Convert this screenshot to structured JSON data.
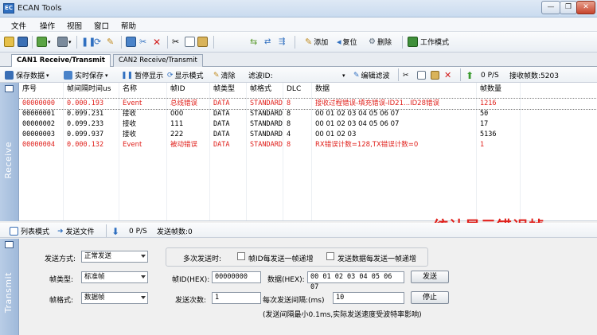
{
  "window": {
    "title": "ECAN Tools",
    "app_icon_text": "EC",
    "min": "—",
    "max": "❐",
    "close": "✕"
  },
  "menu": [
    "文件",
    "操作",
    "视图",
    "窗口",
    "帮助"
  ],
  "toolbar": {
    "add_label": "添加",
    "reset_label": "复位",
    "delete_label": "删除",
    "mode_label": "工作模式"
  },
  "tabs": [
    "CAN1 Receive/Transmit",
    "CAN2 Receive/Transmit"
  ],
  "rx_toolbar": {
    "save_data": "保存数据",
    "realtime_save": "实时保存",
    "pause_display": "暂停显示",
    "display_mode": "显示模式",
    "clear": "清除",
    "filter_id_label": "滤波ID:",
    "edit_filter": "编辑滤波",
    "rate": "0 P/S",
    "recv_frames": "接收帧数:5203"
  },
  "receive_label": "Receive",
  "transmit_label": "Transmit",
  "grid": {
    "columns": [
      "序号",
      "帧间隔时间us",
      "名称",
      "帧ID",
      "帧类型",
      "帧格式",
      "DLC",
      "数据",
      "帧数量"
    ],
    "rows": [
      {
        "cells": [
          "00000000",
          "0.000.193",
          "Event",
          "总线错误",
          "DATA",
          "STANDARD",
          "8",
          "接收过程错误-填充错误-ID21...ID28错误",
          "1216"
        ],
        "error": true
      },
      {
        "cells": [
          "00000001",
          "0.099.231",
          "接收",
          "000",
          "DATA",
          "STANDARD",
          "8",
          "00 01 02 03 04 05 06 07",
          "50"
        ],
        "error": false
      },
      {
        "cells": [
          "00000002",
          "0.099.233",
          "接收",
          "111",
          "DATA",
          "STANDARD",
          "8",
          "00 01 02 03 04 05 06 07",
          "17"
        ],
        "error": false
      },
      {
        "cells": [
          "00000003",
          "0.099.937",
          "接收",
          "222",
          "DATA",
          "STANDARD",
          "4",
          "00 01 02 03",
          "5136"
        ],
        "error": false
      },
      {
        "cells": [
          "00000004",
          "0.000.132",
          "Event",
          "被动错误",
          "DATA",
          "STANDARD",
          "8",
          "RX错误计数=128,TX错误计数=0",
          "1"
        ],
        "error": true
      }
    ]
  },
  "tx_toolbar": {
    "list_mode": "列表模式",
    "send_file": "发送文件",
    "rate": "0 P/S",
    "sent_frames": "发送帧数:0"
  },
  "annotation": "统计显示错误帧",
  "tx": {
    "send_mode_label": "发送方式:",
    "send_mode_value": "正常发送",
    "multi_send_label": "多次发送时:",
    "id_increment_label": "帧ID每发送一帧递增",
    "data_increment_label": "发送数据每发送一帧递增",
    "frame_type_label": "帧类型:",
    "frame_type_value": "标准帧",
    "frame_id_label": "帧ID(HEX):",
    "frame_id_value": "00000000",
    "data_label": "数据(HEX):",
    "data_value": "00 01 02 03 04 05 06 07",
    "send_button": "发送",
    "frame_format_label": "帧格式:",
    "frame_format_value": "数据帧",
    "send_count_label": "发送次数:",
    "send_count_value": "1",
    "interval_label": "每次发送间隔:(ms)",
    "interval_value": "10",
    "stop_button": "停止",
    "note": "(发送间隔最小0.1ms,实际发送速度受波特率影响)"
  },
  "colors": {
    "error_text": "#e0201b",
    "accent": "#2f6fc0"
  }
}
